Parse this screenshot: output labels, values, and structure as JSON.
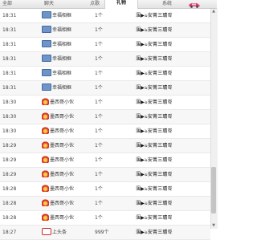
{
  "tabs": [
    {
      "label": "全部",
      "active": false
    },
    {
      "label": "聊天",
      "active": false
    },
    {
      "label": "点歌",
      "active": false
    },
    {
      "label": "礼物",
      "active": true
    },
    {
      "label": "系统",
      "active": false
    }
  ],
  "tab_icon": "car-icon",
  "rows": [
    {
      "time": "18:31",
      "gift": "幸福相框",
      "icon": "car-icon",
      "qty": "1个",
      "user": "涠▶ঌ安菁三聙꺜"
    },
    {
      "time": "18:31",
      "gift": "幸福相框",
      "icon": "car-icon",
      "qty": "1个",
      "user": "涠▶ঌ安菁三聙꺜"
    },
    {
      "time": "18:31",
      "gift": "幸福相框",
      "icon": "car-icon",
      "qty": "1个",
      "user": "涠▶ঌ安菁三聙꺜"
    },
    {
      "time": "18:31",
      "gift": "幸福相框",
      "icon": "car-icon",
      "qty": "1个",
      "user": "涠▶ঌ安菁三聙꺜"
    },
    {
      "time": "18:31",
      "gift": "幸福相框",
      "icon": "car-icon",
      "qty": "1个",
      "user": "涠▶ঌ安菁三聙꺜"
    },
    {
      "time": "18:31",
      "gift": "幸福相框",
      "icon": "car-icon",
      "qty": "1个",
      "user": "涠▶ঌ安菁三聙꺜"
    },
    {
      "time": "18:30",
      "gift": "墨西哥小伙",
      "icon": "fire-icon",
      "qty": "1个",
      "user": "涠▶ঌ安菁三聙꺜"
    },
    {
      "time": "18:30",
      "gift": "墨西哥小伙",
      "icon": "fire-icon",
      "qty": "1个",
      "user": "涠▶ঌ安菁三聙꺜"
    },
    {
      "time": "18:30",
      "gift": "墨西哥小伙",
      "icon": "fire-icon",
      "qty": "1个",
      "user": "涠▶ঌ安菁三聙꺜"
    },
    {
      "time": "18:29",
      "gift": "墨西哥小伙",
      "icon": "fire-icon",
      "qty": "1个",
      "user": "涠▶ঌ安菁三聙꺜"
    },
    {
      "time": "18:29",
      "gift": "墨西哥小伙",
      "icon": "fire-icon",
      "qty": "1个",
      "user": "涠▶ঌ安菁三聙꺜"
    },
    {
      "time": "18:29",
      "gift": "墨西哥小伙",
      "icon": "fire-icon",
      "qty": "1个",
      "user": "涠▶ঌ安菁三聙꺜"
    },
    {
      "time": "18:28",
      "gift": "墨西哥小伙",
      "icon": "fire-icon",
      "qty": "1个",
      "user": "涠▶ঌ安菁三聙꺜"
    },
    {
      "time": "18:28",
      "gift": "墨西哥小伙",
      "icon": "fire-icon",
      "qty": "1个",
      "user": "涠▶ঌ安菁三聙꺜"
    },
    {
      "time": "18:28",
      "gift": "墨西哥小伙",
      "icon": "fire-icon",
      "qty": "1个",
      "user": "涠▶ঌ安菁三聙꺜"
    },
    {
      "time": "18:27",
      "gift": "上头条",
      "icon": "headline-icon",
      "qty": "999个",
      "user": "涠▶ঌ安菁三聙꺜"
    }
  ]
}
